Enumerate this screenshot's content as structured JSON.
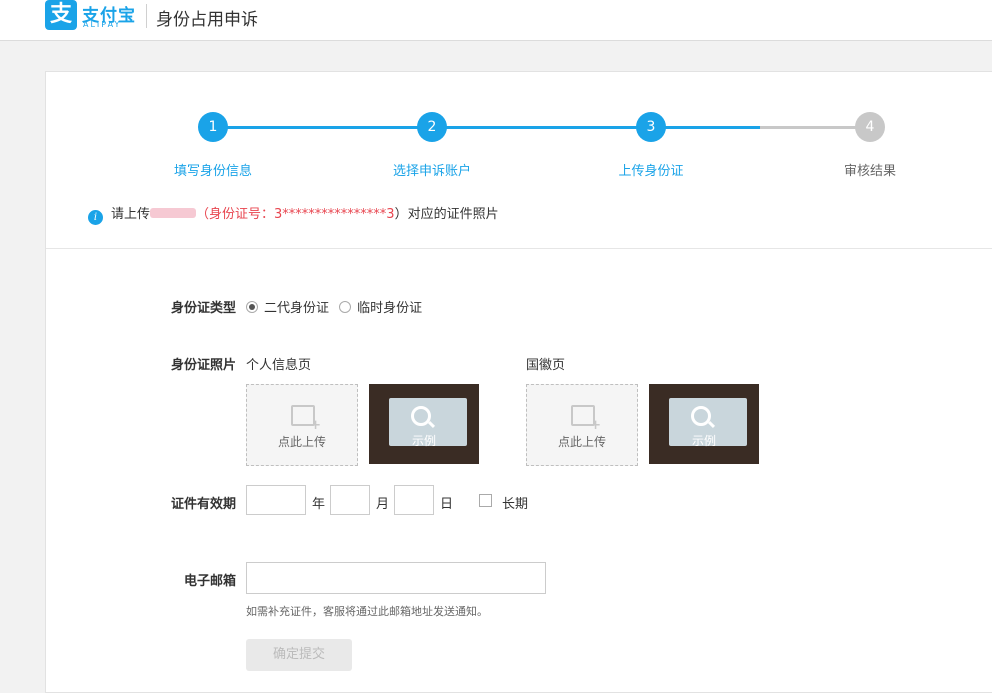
{
  "header": {
    "logo_glyph": "支",
    "logo_text": "支付宝",
    "logo_sub": "ALIPAY",
    "title": "身份占用申诉"
  },
  "steps": [
    {
      "num": "1",
      "label": "填写身份信息",
      "state": "done"
    },
    {
      "num": "2",
      "label": "选择申诉账户",
      "state": "done"
    },
    {
      "num": "3",
      "label": "上传身份证",
      "state": "active"
    },
    {
      "num": "4",
      "label": "审核结果",
      "state": "pending"
    }
  ],
  "notice": {
    "icon": "info-icon",
    "prefix": "请上传",
    "mid": "（身份证号：",
    "id_masked": "3****************3",
    "suffix": "）对应的证件照片"
  },
  "form": {
    "id_type_label": "身份证类型",
    "id_type_options": [
      "二代身份证",
      "临时身份证"
    ],
    "id_type_selected": "二代身份证",
    "photo_label": "身份证照片",
    "front_label": "个人信息页",
    "back_label": "国徽页",
    "upload_text": "点此上传",
    "sample_text": "示例",
    "validity_label": "证件有效期",
    "year_unit": "年",
    "month_unit": "月",
    "day_unit": "日",
    "long_term_label": "长期",
    "email_label": "电子邮箱",
    "email_hint": "如需补充证件，客服将通过此邮箱地址发送通知。",
    "submit_label": "确定提交"
  },
  "colors": {
    "accent": "#1aa3e8",
    "pending": "#c8c8c8",
    "masked_id": "#e8454f"
  }
}
